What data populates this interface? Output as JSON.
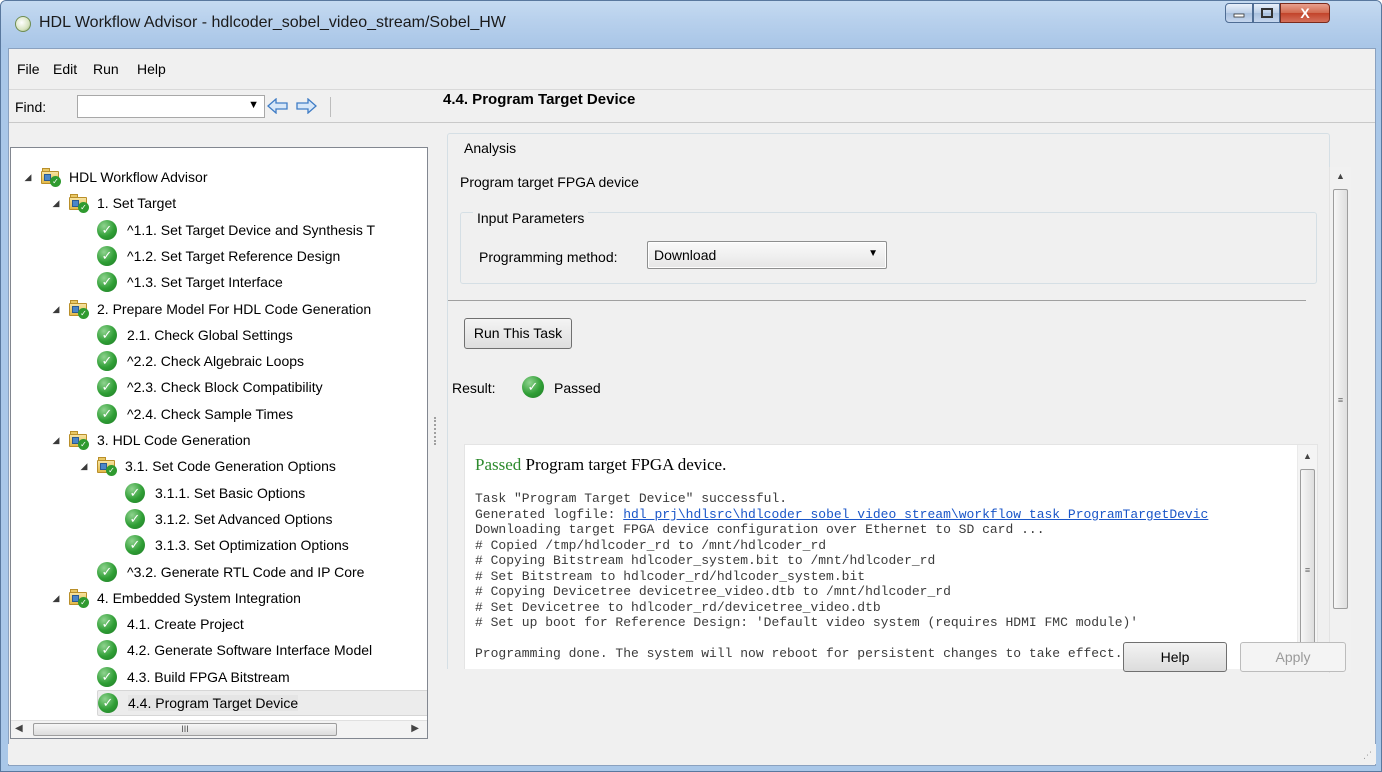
{
  "window": {
    "title": "HDL Workflow Advisor - hdlcoder_sobel_video_stream/Sobel_HW",
    "close_glyph": "X"
  },
  "menu": {
    "items": [
      "File",
      "Edit",
      "Run",
      "Help"
    ]
  },
  "toolbar": {
    "find_label": "Find:",
    "find_value": "",
    "back_icon": "arrow-left-icon",
    "forward_icon": "arrow-right-icon"
  },
  "tree": {
    "items": [
      {
        "label": "HDL Workflow Advisor",
        "level": 0,
        "icon": "folder-check-icon"
      },
      {
        "label": "1. Set Target",
        "level": 1,
        "icon": "folder-check-icon"
      },
      {
        "label": "^1.1. Set Target Device and Synthesis T",
        "level": 2,
        "icon": "check-icon"
      },
      {
        "label": "^1.2. Set Target Reference Design",
        "level": 2,
        "icon": "check-icon"
      },
      {
        "label": "^1.3. Set Target Interface",
        "level": 2,
        "icon": "check-icon"
      },
      {
        "label": "2. Prepare Model For HDL Code Generation",
        "level": 1,
        "icon": "folder-check-icon"
      },
      {
        "label": "2.1. Check Global Settings",
        "level": 2,
        "icon": "check-icon"
      },
      {
        "label": "^2.2. Check Algebraic Loops",
        "level": 2,
        "icon": "check-icon"
      },
      {
        "label": "^2.3. Check Block Compatibility",
        "level": 2,
        "icon": "check-icon"
      },
      {
        "label": "^2.4. Check Sample Times",
        "level": 2,
        "icon": "check-icon"
      },
      {
        "label": "3. HDL Code Generation",
        "level": 1,
        "icon": "folder-check-icon"
      },
      {
        "label": "3.1. Set Code Generation Options",
        "level": 2,
        "icon": "folder-check-icon"
      },
      {
        "label": "3.1.1. Set Basic Options",
        "level": 3,
        "icon": "check-icon"
      },
      {
        "label": "3.1.2. Set Advanced Options",
        "level": 3,
        "icon": "check-icon"
      },
      {
        "label": "3.1.3. Set Optimization Options",
        "level": 3,
        "icon": "check-icon"
      },
      {
        "label": "^3.2. Generate RTL Code and IP Core",
        "level": 2,
        "icon": "check-icon"
      },
      {
        "label": "4. Embedded System Integration",
        "level": 1,
        "icon": "folder-check-icon"
      },
      {
        "label": "4.1. Create Project",
        "level": 2,
        "icon": "check-icon"
      },
      {
        "label": "4.2. Generate Software Interface Model",
        "level": 2,
        "icon": "check-icon"
      },
      {
        "label": "4.3. Build FPGA Bitstream",
        "level": 2,
        "icon": "check-icon"
      },
      {
        "label": "4.4. Program Target Device",
        "level": 2,
        "icon": "check-icon",
        "selected": true
      }
    ],
    "hscroll_grip": "III"
  },
  "task": {
    "title": "4.4. Program Target Device",
    "analysis_legend": "Analysis",
    "description": "Program target FPGA device",
    "input_params_legend": "Input Parameters",
    "programming_method_label": "Programming method:",
    "programming_method_value": "Download",
    "run_button": "Run This Task",
    "result_label": "Result:",
    "result_status": "Passed"
  },
  "log": {
    "passed_word": "Passed",
    "headline_rest": " Program target FPGA device.",
    "lines": [
      "Task \"Program Target Device\" successful.",
      "Generated logfile: ",
      "Downloading target FPGA device configuration over Ethernet to SD card ...",
      "# Copied /tmp/hdlcoder_rd to /mnt/hdlcoder_rd",
      "# Copying Bitstream hdlcoder_system.bit to /mnt/hdlcoder_rd",
      "# Set Bitstream to hdlcoder_rd/hdlcoder_system.bit",
      "# Copying Devicetree devicetree_video.dtb to /mnt/hdlcoder_rd",
      "# Set Devicetree to hdlcoder_rd/devicetree_video.dtb",
      "# Set up boot for Reference Design: 'Default video system (requires HDMI FMC module)'",
      "",
      "Programming done. The system will now reboot for persistent changes to take effect."
    ],
    "logfile_link": "hdl_prj\\hdlsrc\\hdlcoder_sobel_video_stream\\workflow_task_ProgramTargetDevic",
    "scroll_grip": "≡"
  },
  "buttons": {
    "help": "Help",
    "apply": "Apply"
  },
  "colors": {
    "title_bar": "#b7d0ec",
    "pass_green": "#2f9e35",
    "link_blue": "#1a56c8"
  }
}
